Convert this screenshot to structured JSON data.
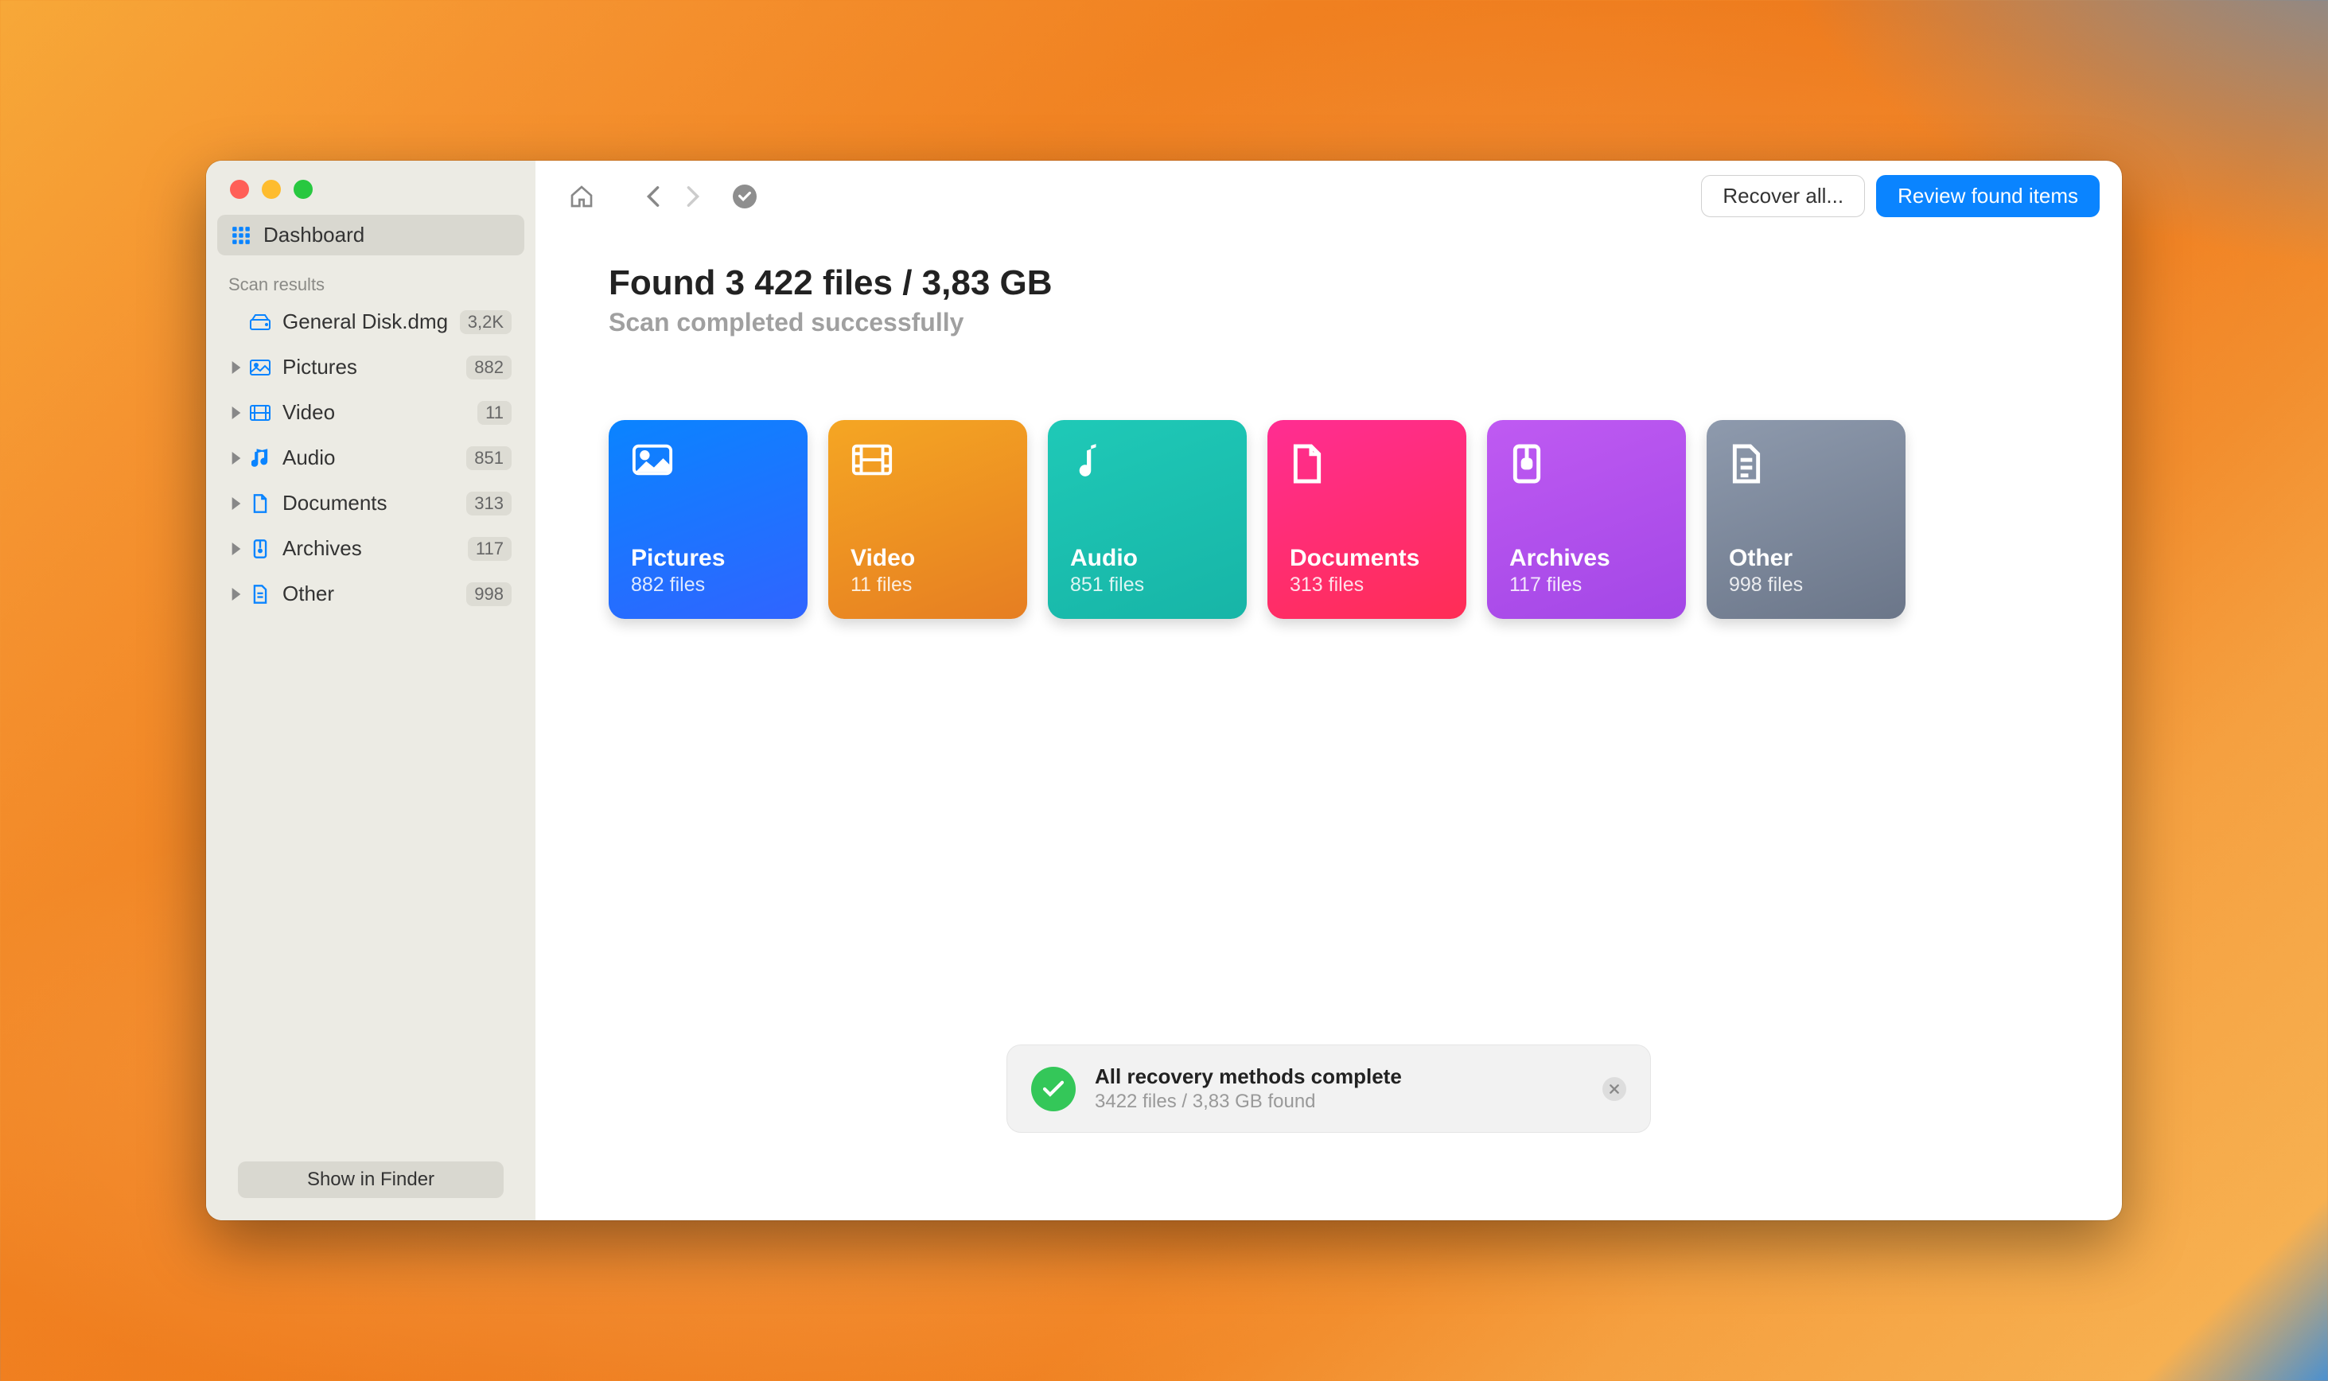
{
  "sidebar": {
    "dashboard_label": "Dashboard",
    "section_label": "Scan results",
    "disk": {
      "label": "General Disk.dmg",
      "count": "3,2K"
    },
    "items": [
      {
        "label": "Pictures",
        "count": "882",
        "icon": "image"
      },
      {
        "label": "Video",
        "count": "11",
        "icon": "video"
      },
      {
        "label": "Audio",
        "count": "851",
        "icon": "audio"
      },
      {
        "label": "Documents",
        "count": "313",
        "icon": "document"
      },
      {
        "label": "Archives",
        "count": "117",
        "icon": "archive"
      },
      {
        "label": "Other",
        "count": "998",
        "icon": "other"
      }
    ],
    "footer_label": "Show in Finder"
  },
  "toolbar": {
    "recover_label": "Recover all...",
    "review_label": "Review found items"
  },
  "main": {
    "headline": "Found 3 422 files / 3,83 GB",
    "subhead": "Scan completed successfully",
    "cards": [
      {
        "title": "Pictures",
        "sub": "882 files",
        "gradient": [
          "#0a84ff",
          "#3064ff"
        ],
        "icon": "image"
      },
      {
        "title": "Video",
        "sub": "11 files",
        "gradient": [
          "#f5a623",
          "#e67e22"
        ],
        "icon": "video"
      },
      {
        "title": "Audio",
        "sub": "851 files",
        "gradient": [
          "#1fc9b7",
          "#17b5a7"
        ],
        "icon": "audio"
      },
      {
        "title": "Documents",
        "sub": "313 files",
        "gradient": [
          "#ff2d92",
          "#ff2d55"
        ],
        "icon": "document"
      },
      {
        "title": "Archives",
        "sub": "117 files",
        "gradient": [
          "#bf5af2",
          "#a347e6"
        ],
        "icon": "archive"
      },
      {
        "title": "Other",
        "sub": "998 files",
        "gradient": [
          "#8e9aad",
          "#6b7689"
        ],
        "icon": "other"
      }
    ]
  },
  "toast": {
    "title": "All recovery methods complete",
    "sub": "3422 files / 3,83 GB found"
  },
  "icons": {
    "sidebar_colors": {
      "image": "#0a84ff",
      "video": "#0a84ff",
      "audio": "#0a84ff",
      "document": "#0a84ff",
      "archive": "#0a84ff",
      "other": "#0a84ff",
      "disk": "#0a84ff"
    }
  }
}
